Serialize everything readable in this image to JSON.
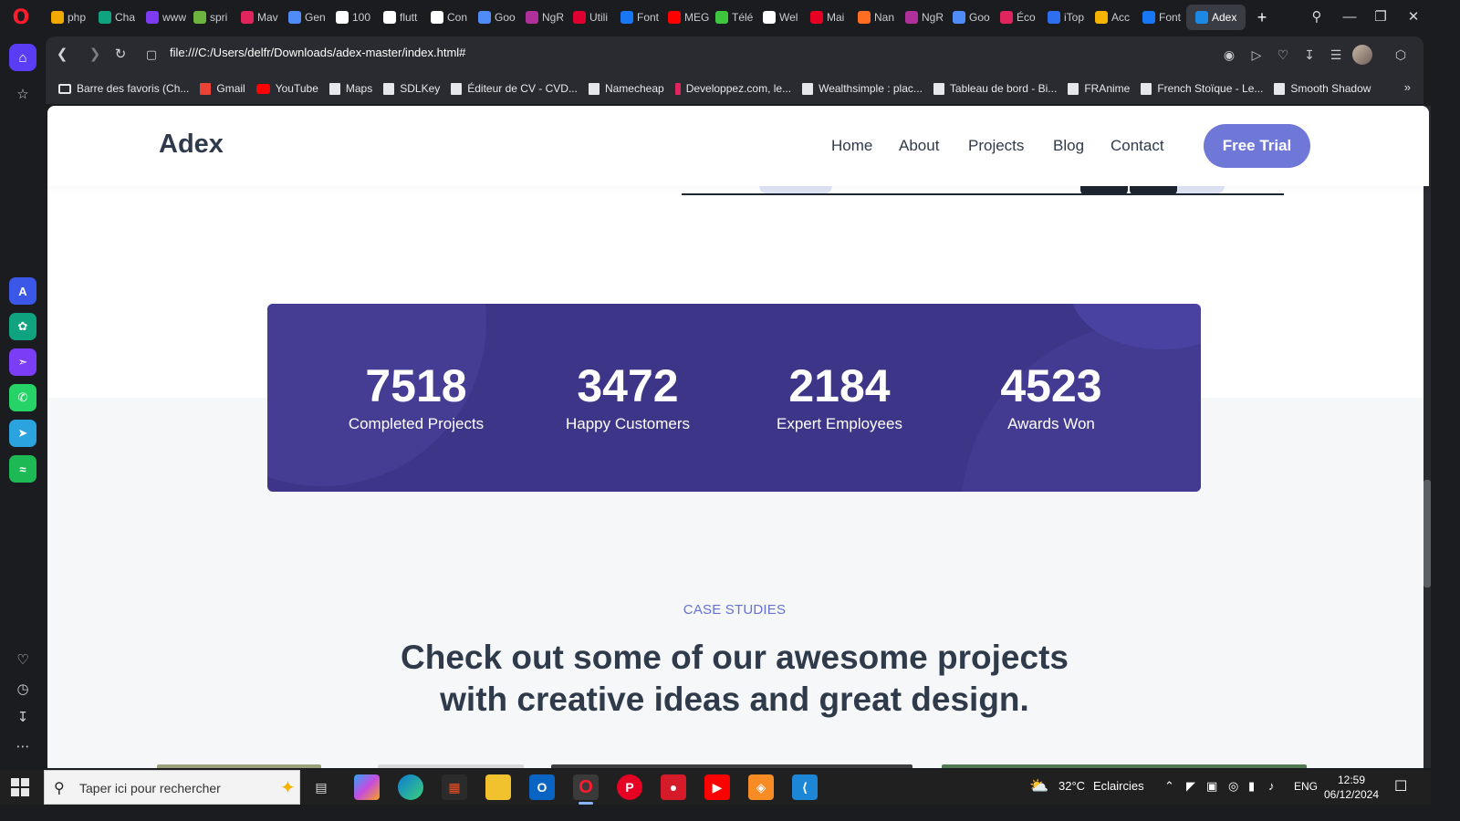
{
  "browser": {
    "tabs": [
      {
        "label": "php",
        "color": "#f2a900"
      },
      {
        "label": "Cha",
        "color": "#10a37f"
      },
      {
        "label": "www",
        "color": "#7d3cf2"
      },
      {
        "label": "spri",
        "color": "#6db33f"
      },
      {
        "label": "Mav",
        "color": "#e0245e"
      },
      {
        "label": "Gen",
        "color": "#4f8cf7"
      },
      {
        "label": "100",
        "color": "#ffffff"
      },
      {
        "label": "flutt",
        "color": "#ffffff"
      },
      {
        "label": "Con",
        "color": "#ffffff"
      },
      {
        "label": "Goo",
        "color": "#4f8cf7"
      },
      {
        "label": "NgR",
        "color": "#b0309b"
      },
      {
        "label": "Utili",
        "color": "#dd0031"
      },
      {
        "label": "Font",
        "color": "#1877f2"
      },
      {
        "label": "MEG",
        "color": "#ff0000"
      },
      {
        "label": "Télé",
        "color": "#3ec63e"
      },
      {
        "label": "Wel",
        "color": "#ffffff"
      },
      {
        "label": "Mai",
        "color": "#e60023"
      },
      {
        "label": "Nan",
        "color": "#ff6d22"
      },
      {
        "label": "NgR",
        "color": "#b0309b"
      },
      {
        "label": "Goo",
        "color": "#4f8cf7"
      },
      {
        "label": "Éco",
        "color": "#e0245e"
      },
      {
        "label": "iTop",
        "color": "#2e6ff2"
      },
      {
        "label": "Acc",
        "color": "#f4b400"
      },
      {
        "label": "Font",
        "color": "#1877f2"
      }
    ],
    "active_tab": {
      "label": "Adex",
      "color": "#1e88e5"
    },
    "url": "file:///C:/Users/delfr/Downloads/adex-master/index.html#",
    "bookmarks": [
      {
        "label": "Barre des favoris (Ch...",
        "kind": "folder"
      },
      {
        "label": "Gmail",
        "kind": "gmail"
      },
      {
        "label": "YouTube",
        "kind": "youtube"
      },
      {
        "label": "Maps",
        "kind": "page"
      },
      {
        "label": "SDLKey",
        "kind": "page"
      },
      {
        "label": "Éditeur de CV - CVD...",
        "kind": "page"
      },
      {
        "label": "Namecheap",
        "kind": "page"
      },
      {
        "label": "Developpez.com, le...",
        "kind": "dev"
      },
      {
        "label": "Wealthsimple : plac...",
        "kind": "page"
      },
      {
        "label": "Tableau de bord - Bi...",
        "kind": "page"
      },
      {
        "label": "FRAnime",
        "kind": "page"
      },
      {
        "label": "French Stoïque - Le...",
        "kind": "page"
      },
      {
        "label": "Smooth Shadow",
        "kind": "page"
      }
    ]
  },
  "site": {
    "logo": "Adex",
    "nav": [
      "Home",
      "About",
      "Projects",
      "Blog",
      "Contact"
    ],
    "cta": "Free Trial",
    "stats": [
      {
        "value": "7518",
        "label": "Completed Projects"
      },
      {
        "value": "3472",
        "label": "Happy Customers"
      },
      {
        "value": "2184",
        "label": "Expert Employees"
      },
      {
        "value": "4523",
        "label": "Awards Won"
      }
    ],
    "case_studies": {
      "eyebrow": "CASE STUDIES",
      "heading_line1": "Check out some of our awesome projects",
      "heading_line2": "with creative ideas and great design."
    },
    "colors": {
      "accent": "#6f78d6",
      "stats_bg": "#3d3588",
      "text": "#2f3a4b"
    }
  },
  "taskbar": {
    "search_placeholder": "Taper ici pour rechercher",
    "weather_temp": "32°C",
    "weather_text": "Eclaircies",
    "language": "ENG",
    "time": "12:59",
    "date": "06/12/2024"
  }
}
